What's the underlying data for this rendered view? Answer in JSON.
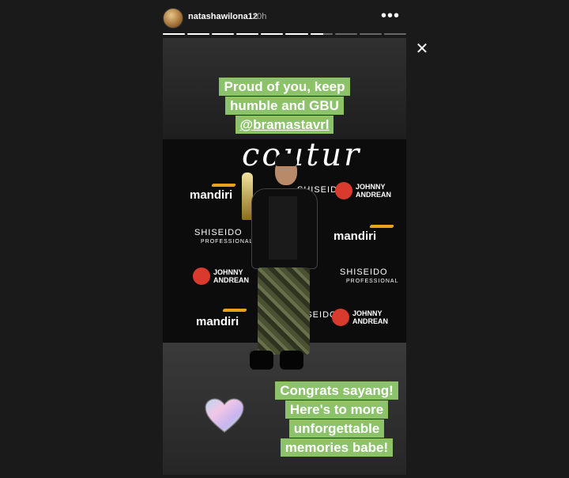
{
  "header": {
    "username": "natashawilona12",
    "time": "10h",
    "more_icon": "more-horizontal-icon"
  },
  "progress": {
    "segments": 10,
    "current_index": 6,
    "current_fill": 0.6
  },
  "story": {
    "caption_top": {
      "line1": "Proud of you, keep",
      "line2": "humble and GBU",
      "mention": "@bramastavrl"
    },
    "caption_bottom": {
      "line1": "Congrats sayang!",
      "line2": "Here's to more",
      "line3": "unforgettable",
      "line4": "memories babe!"
    },
    "backdrop": {
      "script_text": "coutur",
      "mandiri": "mandiri",
      "shiseido": "SHISEIDO",
      "shiseido_sub": "PROFESSIONAL",
      "johnny_1": "JOHNNY",
      "johnny_2": "ANDREAN"
    }
  },
  "colors": {
    "caption_bg": "#8cc36a",
    "background": "#1a1a1a",
    "mandiri_accent": "#e8a31a",
    "johnny_red": "#d83a2e"
  }
}
